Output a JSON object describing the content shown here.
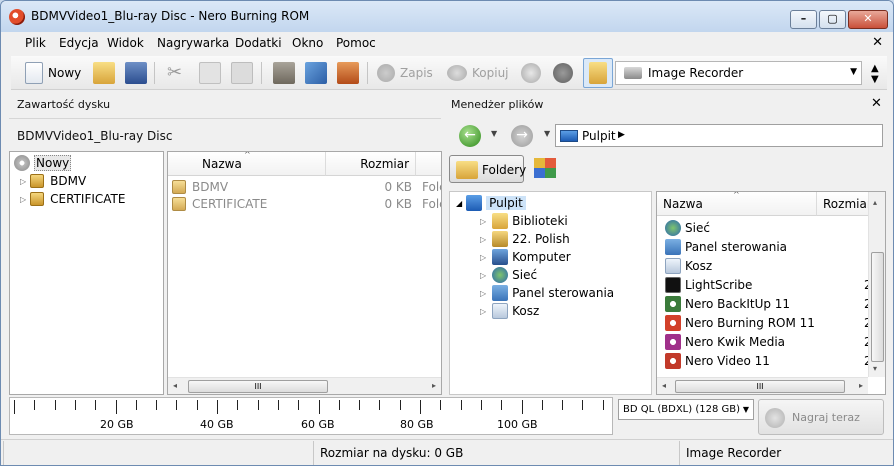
{
  "window": {
    "title": "BDMVVideo1_Blu-ray Disc - Nero Burning ROM",
    "min_glyph": "–",
    "max_glyph": "▢",
    "close_glyph": "✕"
  },
  "menu": [
    "Plik",
    "Edycja",
    "Widok",
    "Nagrywarka",
    "Dodatki",
    "Okno",
    "Pomoc"
  ],
  "toolbar": {
    "new_label": "Nowy",
    "burn_label": "Zapis",
    "copy_label": "Kopiuj",
    "recorder": "Image Recorder"
  },
  "left": {
    "header": "Zawartość dysku",
    "disc_name": "BDMVVideo1_Blu-ray Disc",
    "tree_root": "Nowy",
    "tree": [
      "BDMV",
      "CERTIFICATE"
    ],
    "columns": {
      "name": "Nazwa",
      "size": "Rozmiar",
      "extra": "Folc"
    },
    "files": [
      {
        "name": "BDMV",
        "size": "0 KB",
        "type": "Folc"
      },
      {
        "name": "CERTIFICATE",
        "size": "0 KB",
        "type": "Folc"
      }
    ]
  },
  "right": {
    "header": "Menedżer plików",
    "close_glyph": "✕",
    "address": "Pulpit",
    "folders_button": "Foldery",
    "tree_root": "Pulpit",
    "tree": [
      "Biblioteki",
      "22. Polish",
      "Komputer",
      "Sieć",
      "Panel sterowania",
      "Kosz"
    ],
    "columns": {
      "name": "Nazwa",
      "size": "Rozmiar"
    },
    "items": [
      {
        "name": "Sieć",
        "size": ""
      },
      {
        "name": "Panel sterowania",
        "size": ""
      },
      {
        "name": "Kosz",
        "size": ""
      },
      {
        "name": "LightScribe",
        "size": "2"
      },
      {
        "name": "Nero BackItUp 11",
        "size": "2"
      },
      {
        "name": "Nero Burning ROM 11",
        "size": "2"
      },
      {
        "name": "Nero Kwik Media",
        "size": "2"
      },
      {
        "name": "Nero Video 11",
        "size": "2"
      }
    ]
  },
  "ruler": {
    "labels": [
      "20 GB",
      "40 GB",
      "60 GB",
      "80 GB",
      "100 GB"
    ]
  },
  "disc_type": "BD QL (BDXL) (128 GB)",
  "burn_now": "Nagraj teraz",
  "status": {
    "size": "Rozmiar na dysku: 0 GB",
    "recorder": "Image Recorder"
  },
  "colors": {
    "accent": "#2f7fd6",
    "selection": "#cde3f8",
    "grey_text": "#8a8a8a"
  }
}
